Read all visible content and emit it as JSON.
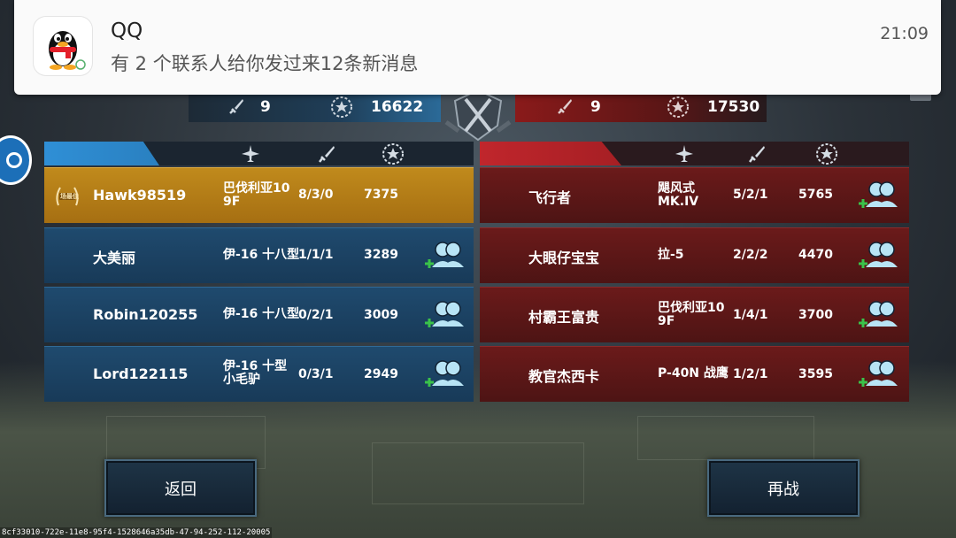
{
  "notification": {
    "app_name": "QQ",
    "message": "有 2 个联系人给你发过来12条新消息",
    "time": "21:09",
    "icon": "qq-penguin-icon"
  },
  "scoreboard": {
    "blue": {
      "kills": "9",
      "score": "16622"
    },
    "red": {
      "kills": "9",
      "score": "17530"
    }
  },
  "blue_team": [
    {
      "name": "Hawk98519",
      "plane": "巴伐利亚10 9F",
      "kda": "8/3/0",
      "score": "7375",
      "badge": "场最佳",
      "highlight": true
    },
    {
      "name": "大美丽",
      "plane": "伊-16 十八型",
      "kda": "1/1/1",
      "score": "3289"
    },
    {
      "name": "Robin120255",
      "plane": "伊-16 十八型",
      "kda": "0/2/1",
      "score": "3009"
    },
    {
      "name": "Lord122115",
      "plane": "伊-16 十型 小毛驴",
      "kda": "0/3/1",
      "score": "2949"
    }
  ],
  "red_team": [
    {
      "name": "飞行者",
      "plane": "飓风式 MK.IV",
      "kda": "5/2/1",
      "score": "5765"
    },
    {
      "name": "大眼仔宝宝",
      "plane": "拉-5",
      "kda": "2/2/2",
      "score": "4470"
    },
    {
      "name": "村霸王富贵",
      "plane": "巴伐利亚10 9F",
      "kda": "1/4/1",
      "score": "3700"
    },
    {
      "name": "教官杰西卡",
      "plane": "P-40N 战鹰",
      "kda": "1/2/1",
      "score": "3595"
    }
  ],
  "buttons": {
    "back": "返回",
    "rematch": "再战"
  },
  "footer_id": "8cf33010-722e-11e8-95f4-1528646a35db-47-94-252-112-20005",
  "colors": {
    "blue": "#1f4a6e",
    "red": "#6b1a1a",
    "gold": "#c08a1c",
    "accent_blue": "#2f8fd6",
    "accent_red": "#c0262c"
  }
}
